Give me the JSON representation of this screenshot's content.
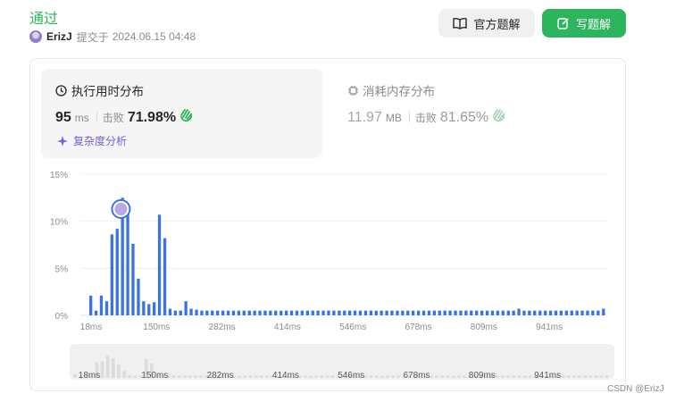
{
  "submission": {
    "status": "通过",
    "username": "ErizJ",
    "submitted_at_prefix": "提交于",
    "submitted_at": "2024.06.15 04:48"
  },
  "buttons": {
    "official_solution": "官方题解",
    "write_solution": "写题解"
  },
  "runtime": {
    "title": "执行用时分布",
    "value": "95",
    "unit": "ms",
    "beat_label": "击败",
    "beat_pct": "71.98%",
    "analysis_label": "复杂度分析"
  },
  "memory": {
    "title": "消耗内存分布",
    "value": "11.97",
    "unit": "MB",
    "beat_label": "击败",
    "beat_pct": "81.65%"
  },
  "colors": {
    "accent_green": "#2db55d",
    "bar_blue": "#3a72e8",
    "purple": "#7b5cd6",
    "thumb_gray": "#dcdcdc"
  },
  "chart_data": {
    "type": "bar",
    "x_unit": "ms",
    "x_tick_labels": [
      "18ms",
      "150ms",
      "282ms",
      "414ms",
      "546ms",
      "678ms",
      "809ms",
      "941ms"
    ],
    "y_tick_labels": [
      "15%",
      "10%",
      "5%",
      "0%"
    ],
    "ylim": [
      0,
      15
    ],
    "grid": true,
    "marker_bar_index": 7,
    "values": [
      2.1,
      0.5,
      2.1,
      1.5,
      8.6,
      9.2,
      12.5,
      11.0,
      7.6,
      3.9,
      1.5,
      1.2,
      1.4,
      10.7,
      8.2,
      0.7,
      0.5,
      0.5,
      1.5,
      0.7,
      0.6,
      0.5,
      0.5,
      0.5,
      0.5,
      0.5,
      0.5,
      0.5,
      0.5,
      0.5,
      0.5,
      0.5,
      0.5,
      0.5,
      0.5,
      0.5,
      0.5,
      0.5,
      0.5,
      0.5,
      0.5,
      0.5,
      0.5,
      0.5,
      0.5,
      0.5,
      0.5,
      0.5,
      0.5,
      0.5,
      0.5,
      0.5,
      0.5,
      0.5,
      0.5,
      0.5,
      0.5,
      0.5,
      0.5,
      0.5,
      0.5,
      0.5,
      0.5,
      0.5,
      0.5,
      0.5,
      0.5,
      0.5,
      0.5,
      0.5,
      0.5,
      0.5,
      0.5,
      0.5,
      0.5,
      0.5,
      0.5,
      0.5,
      0.5,
      0.5,
      0.5,
      0.7,
      0.5,
      0.5,
      0.5,
      0.5,
      0.5,
      0.5,
      0.5,
      0.5,
      0.5,
      0.5,
      0.5,
      0.5,
      0.5,
      0.5,
      0.5,
      0.7
    ]
  },
  "watermark": "CSDN @ErizJ"
}
